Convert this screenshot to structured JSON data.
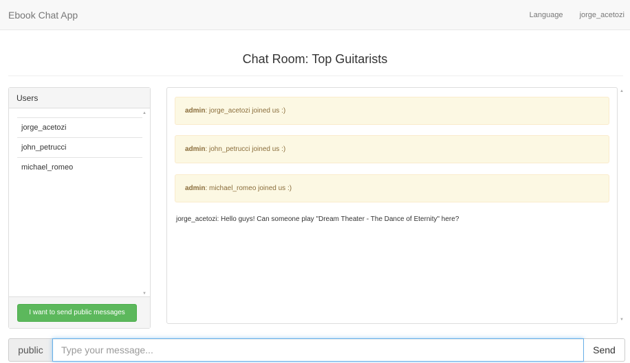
{
  "navbar": {
    "brand": "Ebook Chat App",
    "language_label": "Language",
    "current_user": "jorge_acetozi"
  },
  "page_title": "Chat Room: Top Guitarists",
  "users_panel": {
    "heading": "Users",
    "users": [
      "jorge_acetozi",
      "john_petrucci",
      "michael_romeo"
    ],
    "public_button_label": "I want to send public messages"
  },
  "messages": {
    "system": [
      {
        "sender": "admin",
        "text": ": jorge_acetozi joined us :)"
      },
      {
        "sender": "admin",
        "text": ": john_petrucci joined us :)"
      },
      {
        "sender": "admin",
        "text": ": michael_romeo joined us :)"
      }
    ],
    "chat": [
      {
        "text": "jorge_acetozi: Hello guys! Can someone play \"Dream Theater - The Dance of Eternity\" here?"
      }
    ]
  },
  "input_bar": {
    "mode_label": "public",
    "placeholder": "Type your message...",
    "value": "",
    "send_label": "Send"
  },
  "colors": {
    "navbar_bg": "#f8f8f8",
    "success_green": "#5cb85c",
    "warning_bg": "#fcf8e3",
    "warning_text": "#8a6d3b",
    "focus_blue": "#66afe9"
  }
}
